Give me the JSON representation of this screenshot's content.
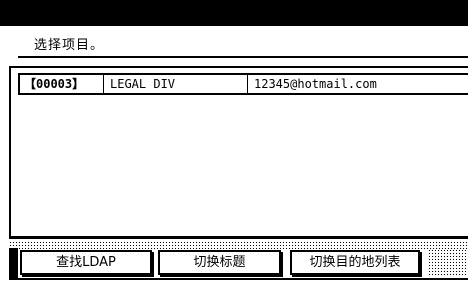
{
  "header": {
    "prompt": "选择项目。"
  },
  "list": {
    "rows": [
      {
        "code": "【00003】",
        "name": "LEGAL DIV",
        "email": "12345@hotmail.com"
      }
    ]
  },
  "buttons": {
    "search_ldap": "查找LDAP",
    "switch_title": "切换标题",
    "switch_destination_list": "切换目的地列表"
  }
}
